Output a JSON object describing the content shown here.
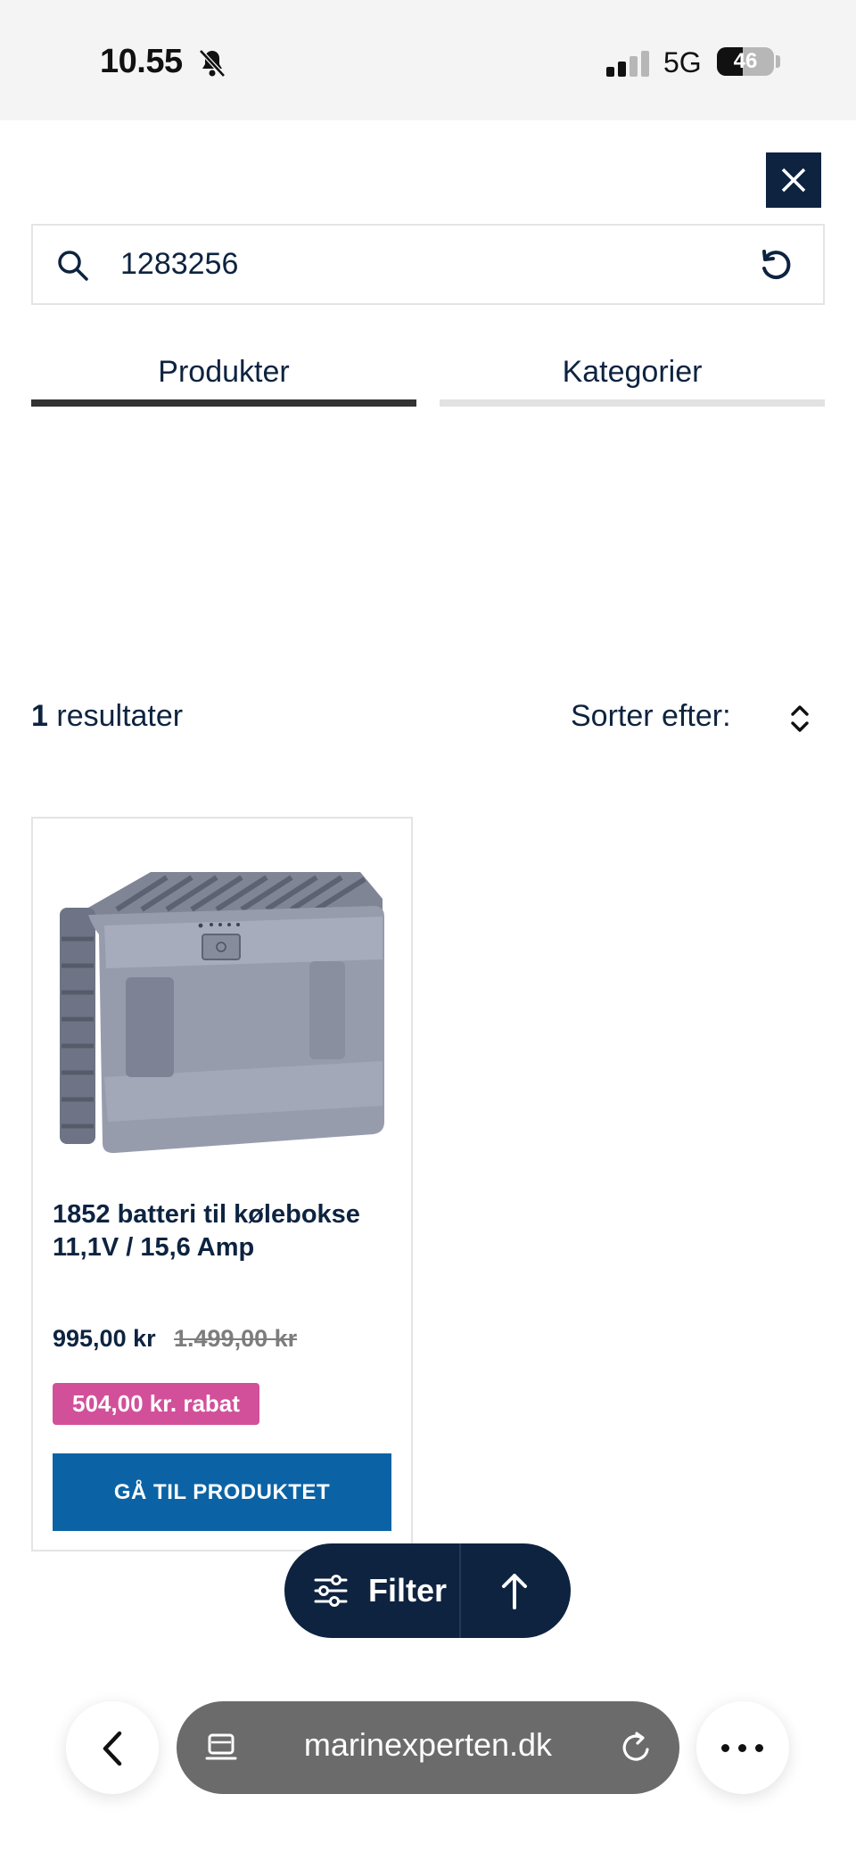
{
  "status_bar": {
    "time": "10.55",
    "network": "5G",
    "battery": "46",
    "battery_level": 0.46
  },
  "search": {
    "value": "1283256"
  },
  "tabs": [
    {
      "label": "Produkter",
      "active": true
    },
    {
      "label": "Kategorier",
      "active": false
    }
  ],
  "results": {
    "count": "1",
    "label": "resultater",
    "sort_label": "Sorter efter:"
  },
  "product": {
    "title": "1852 batteri til kølebokse 11,1V / 15,6 Amp",
    "price": "995,00 kr",
    "old_price": "1.499,00 kr",
    "discount": "504,00 kr. rabat",
    "cta": "GÅ TIL PRODUKTET"
  },
  "floating": {
    "filter_label": "Filter"
  },
  "browser": {
    "url": "marinexperten.dk"
  },
  "colors": {
    "navy": "#0d2340",
    "cta_blue": "#0b63a5",
    "discount_pink": "#d2509a"
  }
}
